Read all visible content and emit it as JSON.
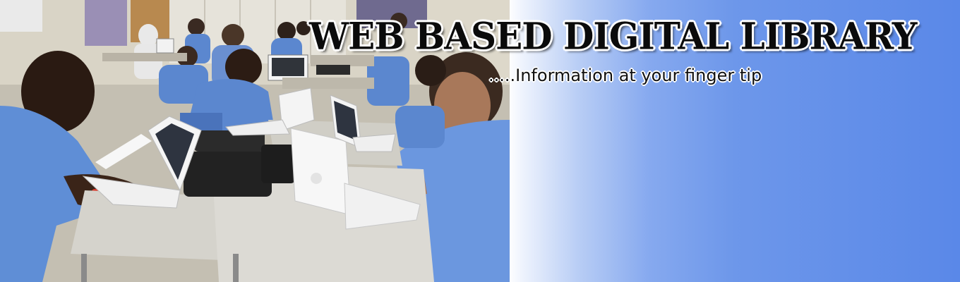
{
  "banner": {
    "title": "WEB BASED DIGITAL LIBRARY",
    "tagline": ".....Information at your finger tip",
    "photo_description_icon": "students-with-laptops-photo"
  },
  "colors": {
    "gradient_start": "#ffffff",
    "gradient_end": "#5a88e8",
    "title_text": "#0b0b0b",
    "title_outline": "#ffffff",
    "uniform_blue": "#5b87cf"
  }
}
